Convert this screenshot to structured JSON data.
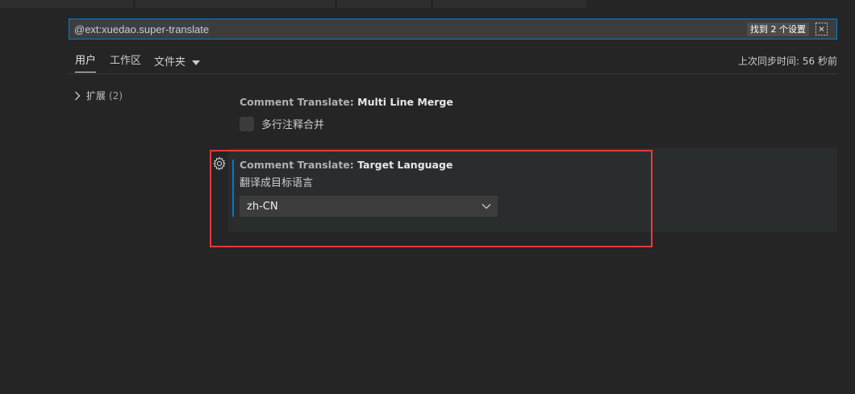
{
  "search": {
    "query": "@ext:xuedao.super-translate",
    "result_count": "找到 2 个设置"
  },
  "tabs": [
    {
      "label": "用户",
      "active": true
    },
    {
      "label": "工作区",
      "active": false
    },
    {
      "label": "文件夹",
      "active": false
    }
  ],
  "sync_status": "上次同步时间: 56 秒前",
  "tree": {
    "label": "扩展",
    "count": "(2)"
  },
  "settings": [
    {
      "category": "Comment Translate: ",
      "name": "Multi Line Merge",
      "description": "多行注释合并",
      "checked": false
    },
    {
      "category": "Comment Translate: ",
      "name": "Target Language",
      "description": "翻译成目标语言",
      "value": "zh-CN"
    }
  ],
  "colors": {
    "accent": "#007acc",
    "highlight": "#e83a3a"
  }
}
